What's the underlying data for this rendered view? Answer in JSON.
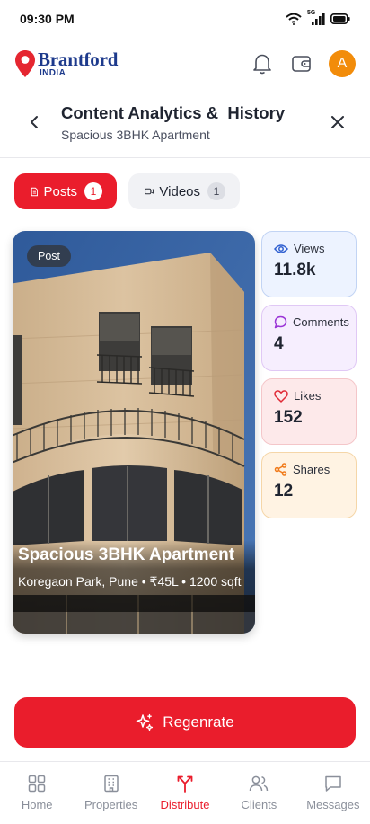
{
  "status_bar": {
    "time": "09:30 PM",
    "network_label": "5G"
  },
  "brand": {
    "name": "Brantford",
    "sub": "INDIA"
  },
  "header": {
    "avatar_initial": "A"
  },
  "page": {
    "title": "Content Analytics &  History",
    "subtitle": "Spacious 3BHK Apartment"
  },
  "tabs": [
    {
      "label": "Posts",
      "count": "1",
      "active": true
    },
    {
      "label": "Videos",
      "count": "1",
      "active": false
    }
  ],
  "post": {
    "badge": "Post",
    "title": "Spacious 3BHK Apartment",
    "meta": "Koregaon Park, Pune • ₹45L • 1200 sqft"
  },
  "stats": [
    {
      "label": "Views",
      "value": "11.8k",
      "icon": "eye-icon",
      "color": "#2f5fd0"
    },
    {
      "label": "Comments",
      "value": "4",
      "icon": "comment-icon",
      "color": "#9b35d6"
    },
    {
      "label": "Likes",
      "value": "152",
      "icon": "heart-icon",
      "color": "#e02a36"
    },
    {
      "label": "Shares",
      "value": "12",
      "icon": "share-icon",
      "color": "#f07a1a"
    }
  ],
  "action": {
    "regenerate_label": "Regenrate"
  },
  "nav": [
    {
      "label": "Home",
      "icon": "grid-icon",
      "active": false
    },
    {
      "label": "Properties",
      "icon": "building-icon",
      "active": false
    },
    {
      "label": "Distribute",
      "icon": "split-arrow-icon",
      "active": true
    },
    {
      "label": "Clients",
      "icon": "users-icon",
      "active": false
    },
    {
      "label": "Messages",
      "icon": "message-icon",
      "active": false
    }
  ],
  "colors": {
    "accent": "#ea1d2c",
    "brand_blue": "#1d3a8c",
    "avatar": "#f28c0a"
  }
}
